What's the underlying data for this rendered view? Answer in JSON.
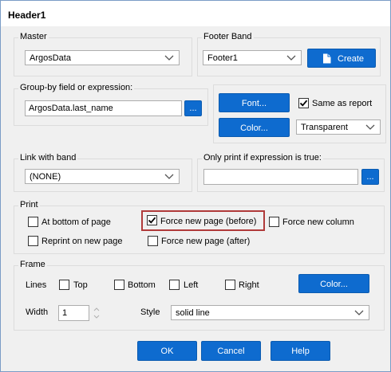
{
  "window": {
    "title": "Header1"
  },
  "master": {
    "legend": "Master",
    "selected": "ArgosData"
  },
  "footer_band": {
    "legend": "Footer Band",
    "selected": "Footer1",
    "create_label": "Create"
  },
  "group_by": {
    "legend": "Group-by field or expression:",
    "value": "ArgosData.last_name",
    "browse_label": "..."
  },
  "appearance": {
    "font_label": "Font...",
    "color_label": "Color...",
    "same_as_report_label": "Same as report",
    "same_as_report_checked": true,
    "background_selected": "Transparent"
  },
  "link_with_band": {
    "legend": "Link with band",
    "selected": "(NONE)"
  },
  "only_print": {
    "legend": "Only print if expression is true:",
    "value": "",
    "browse_label": "..."
  },
  "print": {
    "legend": "Print",
    "at_bottom_label": "At bottom of page",
    "at_bottom_checked": false,
    "reprint_label": "Reprint on new page",
    "reprint_checked": false,
    "force_before_label": "Force new page (before)",
    "force_before_checked": true,
    "force_after_label": "Force new page (after)",
    "force_after_checked": false,
    "force_column_label": "Force new column",
    "force_column_checked": false
  },
  "frame": {
    "legend": "Frame",
    "lines_label": "Lines",
    "top_label": "Top",
    "bottom_label": "Bottom",
    "left_label": "Left",
    "right_label": "Right",
    "color_label": "Color...",
    "width_label": "Width",
    "width_value": "1",
    "style_label": "Style",
    "style_selected": "solid line"
  },
  "buttons": {
    "ok": "OK",
    "cancel": "Cancel",
    "help": "Help"
  },
  "colors": {
    "accent": "#0e6bcf",
    "highlight": "#b03a3a"
  }
}
